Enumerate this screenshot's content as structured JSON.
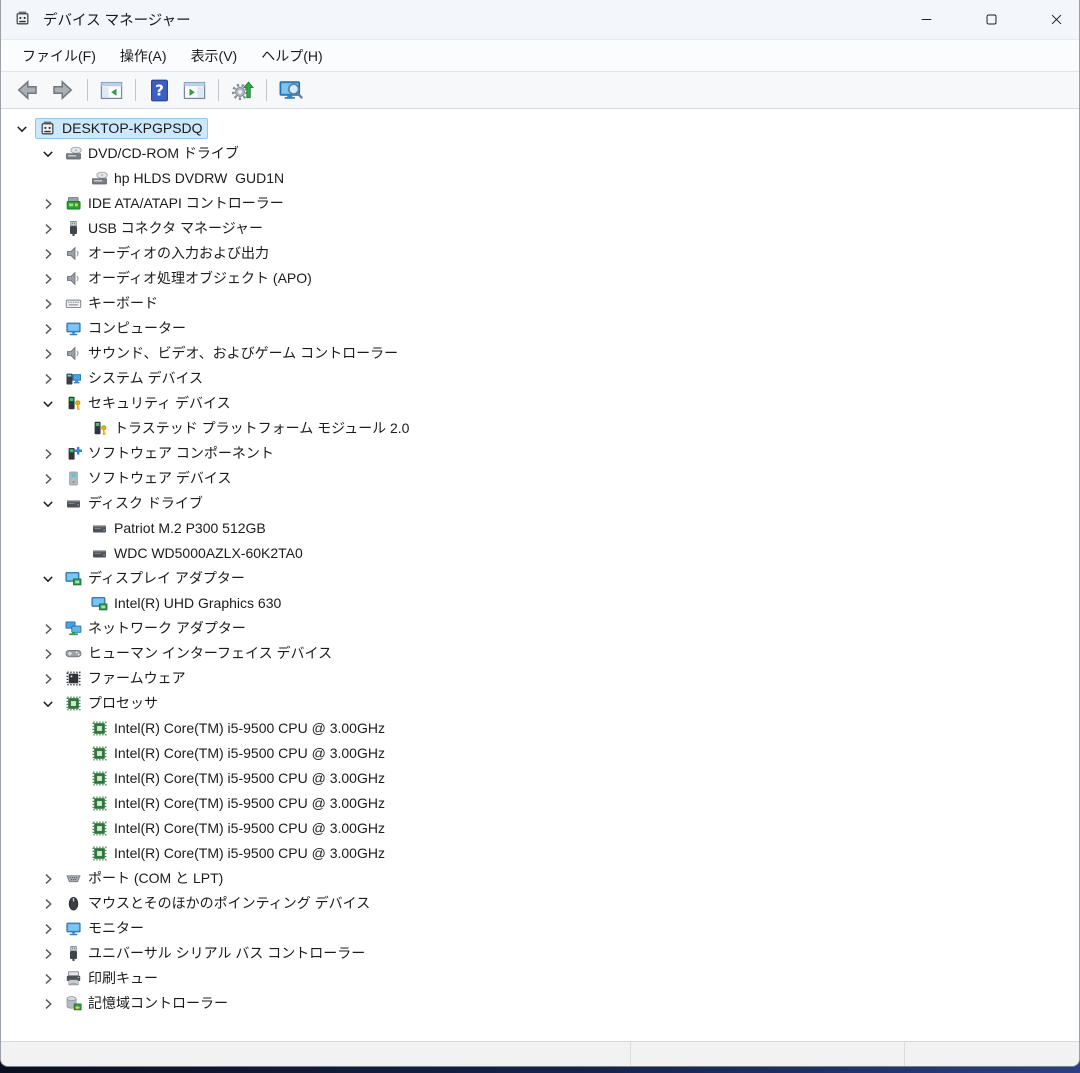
{
  "window": {
    "title": "デバイス マネージャー",
    "icon": "device-manager-icon"
  },
  "window_controls": [
    {
      "name": "minimize",
      "icon": "minimize-icon"
    },
    {
      "name": "maximize",
      "icon": "maximize-icon"
    },
    {
      "name": "close",
      "icon": "close-icon"
    }
  ],
  "menu": {
    "items": [
      {
        "name": "file",
        "label": "ファイル(F)"
      },
      {
        "name": "action",
        "label": "操作(A)"
      },
      {
        "name": "view",
        "label": "表示(V)"
      },
      {
        "name": "help",
        "label": "ヘルプ(H)"
      }
    ]
  },
  "toolbar": {
    "buttons": [
      {
        "type": "button",
        "name": "back",
        "icon": "back-arrow-icon"
      },
      {
        "type": "button",
        "name": "forward",
        "icon": "forward-arrow-icon"
      },
      {
        "type": "sep"
      },
      {
        "type": "button",
        "name": "show-console-tree",
        "icon": "console-tree-icon"
      },
      {
        "type": "sep"
      },
      {
        "type": "button",
        "name": "help",
        "icon": "help-icon"
      },
      {
        "type": "button",
        "name": "show-action-pane",
        "icon": "action-pane-icon"
      },
      {
        "type": "sep"
      },
      {
        "type": "button",
        "name": "scan-hardware-changes",
        "icon": "scan-hardware-icon"
      },
      {
        "type": "sep"
      },
      {
        "type": "button",
        "name": "device-view",
        "icon": "device-search-icon"
      }
    ]
  },
  "tree": {
    "items": [
      {
        "depth": 0,
        "state": "expanded",
        "icon": "device-manager-icon",
        "label": "DESKTOP-KPGPSDQ",
        "selected": true
      },
      {
        "depth": 1,
        "state": "expanded",
        "icon": "cd-drive-icon",
        "label": "DVD/CD-ROM ドライブ"
      },
      {
        "depth": 2,
        "state": "leaf",
        "icon": "cd-drive-icon",
        "label": "hp HLDS DVDRW  GUD1N"
      },
      {
        "depth": 1,
        "state": "collapsed",
        "icon": "ide-controller-icon",
        "label": "IDE ATA/ATAPI コントローラー"
      },
      {
        "depth": 1,
        "state": "collapsed",
        "icon": "usb-plug-icon",
        "label": "USB コネクタ マネージャー"
      },
      {
        "depth": 1,
        "state": "collapsed",
        "icon": "speaker-icon",
        "label": "オーディオの入力および出力"
      },
      {
        "depth": 1,
        "state": "collapsed",
        "icon": "speaker-icon",
        "label": "オーディオ処理オブジェクト (APO)"
      },
      {
        "depth": 1,
        "state": "collapsed",
        "icon": "keyboard-icon",
        "label": "キーボード"
      },
      {
        "depth": 1,
        "state": "collapsed",
        "icon": "monitor-icon",
        "label": "コンピューター"
      },
      {
        "depth": 1,
        "state": "collapsed",
        "icon": "speaker-icon",
        "label": "サウンド、ビデオ、およびゲーム コントローラー"
      },
      {
        "depth": 1,
        "state": "collapsed",
        "icon": "system-devices-icon",
        "label": "システム デバイス"
      },
      {
        "depth": 1,
        "state": "expanded",
        "icon": "security-device-icon",
        "label": "セキュリティ デバイス"
      },
      {
        "depth": 2,
        "state": "leaf",
        "icon": "security-device-icon",
        "label": "トラステッド プラットフォーム モジュール 2.0"
      },
      {
        "depth": 1,
        "state": "collapsed",
        "icon": "software-component-icon",
        "label": "ソフトウェア コンポーネント"
      },
      {
        "depth": 1,
        "state": "collapsed",
        "icon": "software-device-icon",
        "label": "ソフトウェア デバイス"
      },
      {
        "depth": 1,
        "state": "expanded",
        "icon": "disk-drive-icon",
        "label": "ディスク ドライブ"
      },
      {
        "depth": 2,
        "state": "leaf",
        "icon": "disk-drive-icon",
        "label": "Patriot M.2 P300 512GB"
      },
      {
        "depth": 2,
        "state": "leaf",
        "icon": "disk-drive-icon",
        "label": "WDC WD5000AZLX-60K2TA0"
      },
      {
        "depth": 1,
        "state": "expanded",
        "icon": "display-adapter-icon",
        "label": "ディスプレイ アダプター"
      },
      {
        "depth": 2,
        "state": "leaf",
        "icon": "display-adapter-icon",
        "label": "Intel(R) UHD Graphics 630"
      },
      {
        "depth": 1,
        "state": "collapsed",
        "icon": "network-adapter-icon",
        "label": "ネットワーク アダプター"
      },
      {
        "depth": 1,
        "state": "collapsed",
        "icon": "gamepad-icon",
        "label": "ヒューマン インターフェイス デバイス"
      },
      {
        "depth": 1,
        "state": "collapsed",
        "icon": "firmware-chip-icon",
        "label": "ファームウェア"
      },
      {
        "depth": 1,
        "state": "expanded",
        "icon": "processor-icon",
        "label": "プロセッサ"
      },
      {
        "depth": 2,
        "state": "leaf",
        "icon": "processor-icon",
        "label": "Intel(R) Core(TM) i5-9500 CPU @ 3.00GHz"
      },
      {
        "depth": 2,
        "state": "leaf",
        "icon": "processor-icon",
        "label": "Intel(R) Core(TM) i5-9500 CPU @ 3.00GHz"
      },
      {
        "depth": 2,
        "state": "leaf",
        "icon": "processor-icon",
        "label": "Intel(R) Core(TM) i5-9500 CPU @ 3.00GHz"
      },
      {
        "depth": 2,
        "state": "leaf",
        "icon": "processor-icon",
        "label": "Intel(R) Core(TM) i5-9500 CPU @ 3.00GHz"
      },
      {
        "depth": 2,
        "state": "leaf",
        "icon": "processor-icon",
        "label": "Intel(R) Core(TM) i5-9500 CPU @ 3.00GHz"
      },
      {
        "depth": 2,
        "state": "leaf",
        "icon": "processor-icon",
        "label": "Intel(R) Core(TM) i5-9500 CPU @ 3.00GHz"
      },
      {
        "depth": 1,
        "state": "collapsed",
        "icon": "serial-port-icon",
        "label": "ポート (COM と LPT)"
      },
      {
        "depth": 1,
        "state": "collapsed",
        "icon": "mouse-icon",
        "label": "マウスとそのほかのポインティング デバイス"
      },
      {
        "depth": 1,
        "state": "collapsed",
        "icon": "monitor-icon",
        "label": "モニター"
      },
      {
        "depth": 1,
        "state": "collapsed",
        "icon": "usb-plug-icon",
        "label": "ユニバーサル シリアル バス コントローラー"
      },
      {
        "depth": 1,
        "state": "collapsed",
        "icon": "printer-icon",
        "label": "印刷キュー"
      },
      {
        "depth": 1,
        "state": "collapsed",
        "icon": "storage-controller-icon",
        "label": "記憶域コントローラー"
      }
    ]
  },
  "statusbar": {
    "sections": [
      "",
      "",
      ""
    ]
  },
  "colors": {
    "titlebar_bg": "#f3f6fb",
    "selection_bg": "#cce8ff",
    "selection_border": "#8ec8f0",
    "window_bottom_strip": "#15234e"
  }
}
